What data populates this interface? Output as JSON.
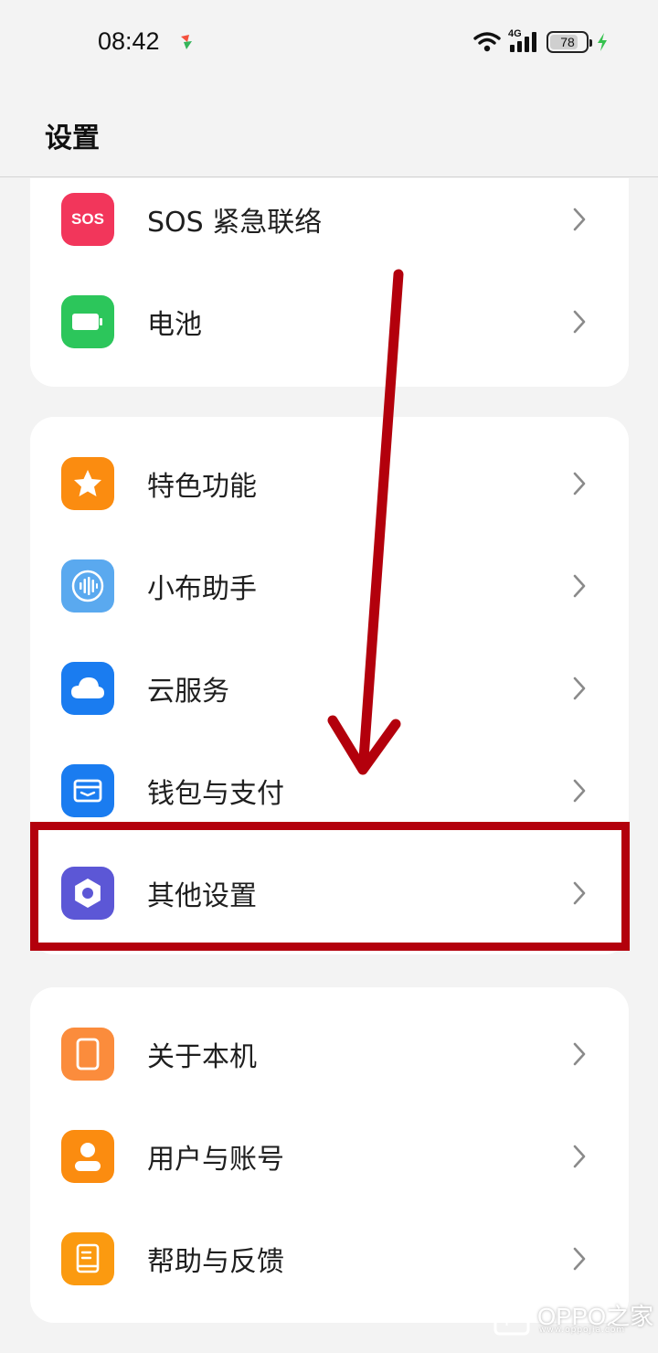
{
  "status_bar": {
    "time": "08:42",
    "network_label": "4G",
    "battery_level": "78",
    "battery_fraction": 0.78,
    "charging": true,
    "icons": [
      "app-notification-icon",
      "wifi-icon",
      "cellular-signal-icon",
      "battery-icon",
      "charging-bolt-icon"
    ]
  },
  "header": {
    "title": "设置"
  },
  "groups": [
    {
      "items": [
        {
          "label": "SOS 紧急联络",
          "icon": "sos-icon",
          "icon_text": "SOS",
          "icon_color": "#f2365b"
        },
        {
          "label": "电池",
          "icon": "battery-settings-icon",
          "icon_color": "#2cc65b"
        }
      ]
    },
    {
      "items": [
        {
          "label": "特色功能",
          "icon": "star-icon",
          "icon_color": "#fb8c10"
        },
        {
          "label": "小布助手",
          "icon": "voice-assistant-icon",
          "icon_color": "#5aa9ef"
        },
        {
          "label": "云服务",
          "icon": "cloud-icon",
          "icon_color": "#1a7cf0"
        },
        {
          "label": "钱包与支付",
          "icon": "wallet-icon",
          "icon_color": "#1a7cf0"
        },
        {
          "label": "其他设置",
          "icon": "gear-icon",
          "icon_color": "#5c57d6"
        }
      ]
    },
    {
      "items": [
        {
          "label": "关于本机",
          "icon": "phone-icon",
          "icon_color": "#fb8c3c"
        },
        {
          "label": "用户与账号",
          "icon": "user-icon",
          "icon_color": "#fb8c10"
        },
        {
          "label": "帮助与反馈",
          "icon": "help-book-icon",
          "icon_color": "#fb9a10"
        }
      ]
    }
  ],
  "annotation": {
    "color": "#b3000c",
    "highlighted_item": "其他设置"
  },
  "watermark": {
    "text": "OPPO之家",
    "subtext": "www.oppojia.com"
  }
}
